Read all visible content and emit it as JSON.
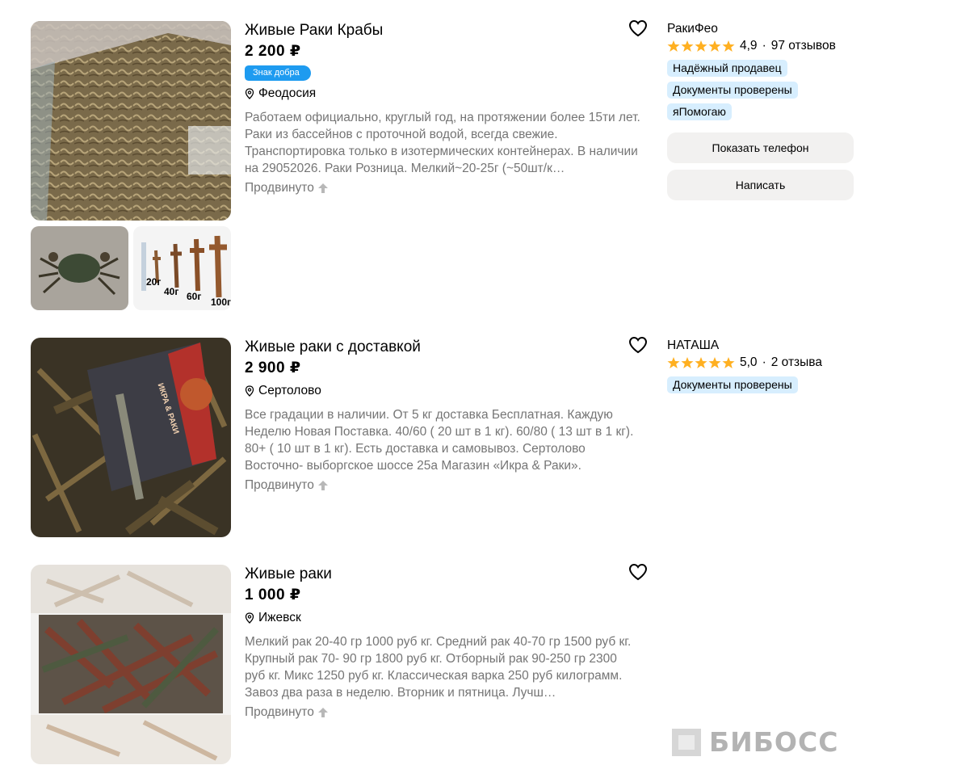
{
  "listings": [
    {
      "title": "Живые Раки Крабы",
      "price": "2 200 ₽",
      "badge": "Знак добра",
      "location": "Феодосия",
      "description": "Работаем официально, круглый год, на протяжении более 15ти лет. Раки из бассейнов с проточной водой, всегда свежие. Транспортировка только в изотермических контейнерах. В наличии на 29052026. Раки Розница. Мелкий~20-25г (~50шт/к…",
      "promoted": "Продвинуто",
      "thumb_labels": [
        "20г",
        "40г",
        "60г",
        "100г"
      ],
      "seller": {
        "name": "РакиФео",
        "rating": "4,9",
        "reviews": "97 отзывов",
        "tags": [
          "Надёжный продавец",
          "Документы проверены",
          "яПомогаю"
        ],
        "show_phone_label": "Показать телефон",
        "write_label": "Написать"
      }
    },
    {
      "title": "Живые раки с доставкой",
      "price": "2 900 ₽",
      "location": "Сертолово",
      "description": "Все градации в наличии. От 5 кг доставка Бесплатная. Каждую Неделю Новая Поставка. 40/60 ( 20 шт в 1 кг). 60/80 ( 13 шт в 1 кг). 80+ ( 10 шт в 1 кг). Есть доставка и самовывоз. Сертолово Восточно- выборгское шоссе 25а Магазин «Икра & Раки».",
      "promoted": "Продвинуто",
      "photo_label": "ИКРА & РАКИ",
      "seller": {
        "name": "НАТАША",
        "rating": "5,0",
        "reviews": "2 отзыва",
        "tags": [
          "Документы проверены"
        ]
      }
    },
    {
      "title": "Живые раки",
      "price": "1 000 ₽",
      "location": "Ижевск",
      "description": "Мелкий рак 20-40 гр 1000 руб кг. Средний рак 40-70 гр 1500 руб кг. Крупный рак 70- 90 гр 1800 руб кг. Отборный рак 90-250 гр 2300 руб кг. Микс 1250 руб кг. Классическая варка 250 руб килограмм. Завоз два раза в неделю. Вторник и пятница. Лучш…",
      "promoted": "Продвинуто"
    }
  ],
  "watermark": "БИБОСС",
  "colors": {
    "badge": "#1e9bf0",
    "tag_bg": "#d7eefe",
    "star": "#ffb021",
    "muted_text": "#757575",
    "button_bg": "#f2f1f0"
  }
}
